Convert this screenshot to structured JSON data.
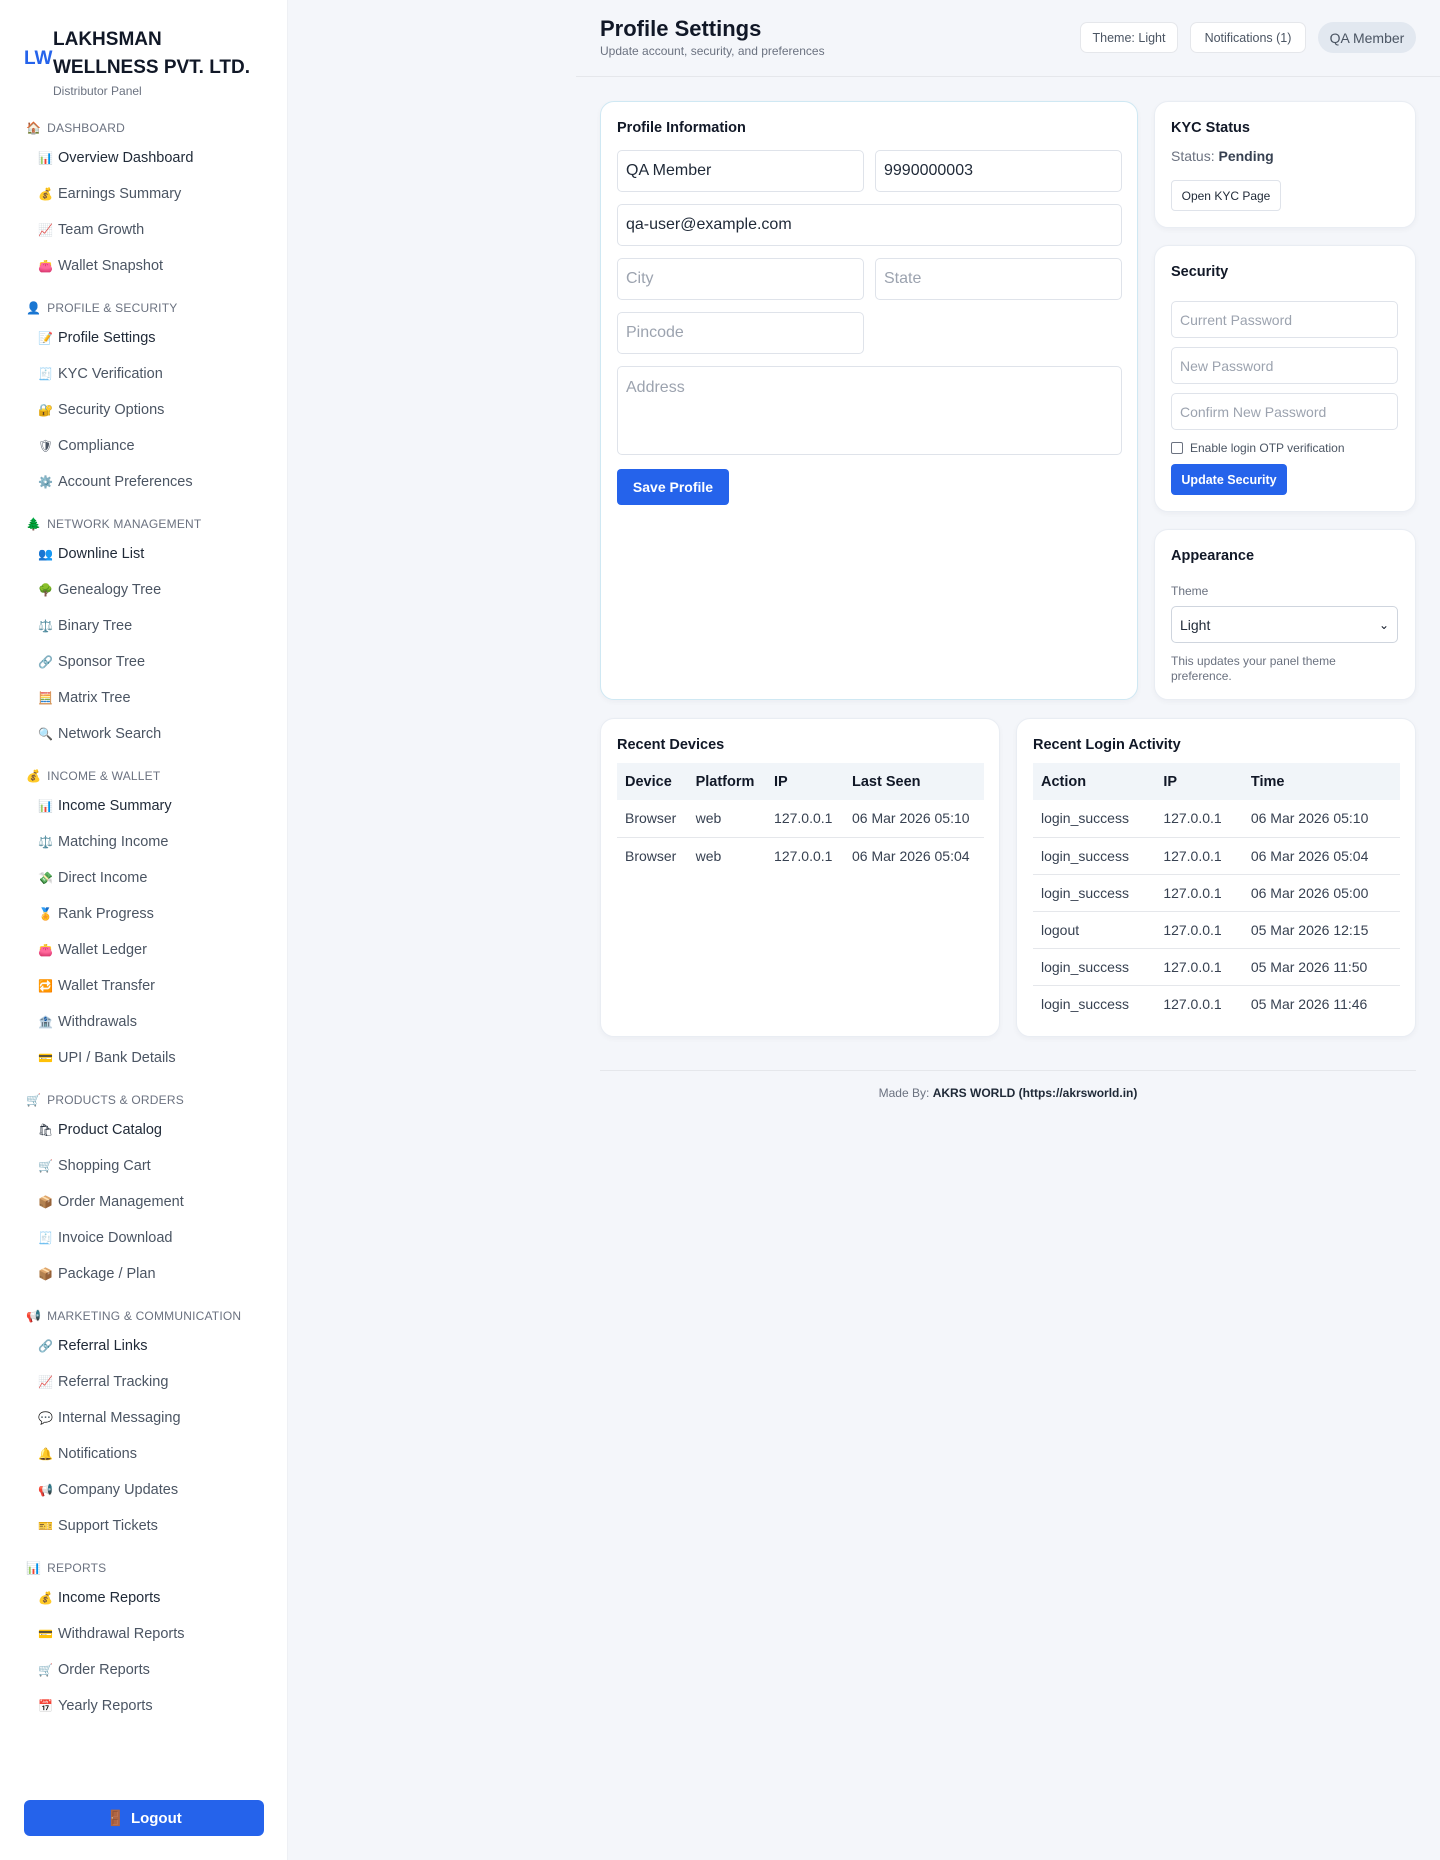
{
  "brand": {
    "logo": "LW",
    "name": "LAKHSMAN WELLNESS PVT. LTD.",
    "sub": "Distributor Panel"
  },
  "sidebar": {
    "sections": [
      {
        "heading": "DASHBOARD",
        "icon": "🏠",
        "items": [
          {
            "label": "Overview Dashboard",
            "icon": "📊"
          },
          {
            "label": "Earnings Summary",
            "icon": "💰"
          },
          {
            "label": "Team Growth",
            "icon": "📈"
          },
          {
            "label": "Wallet Snapshot",
            "icon": "👛"
          }
        ]
      },
      {
        "heading": "PROFILE & SECURITY",
        "icon": "👤",
        "items": [
          {
            "label": "Profile Settings",
            "icon": "📝"
          },
          {
            "label": "KYC Verification",
            "icon": "🧾"
          },
          {
            "label": "Security Options",
            "icon": "🔐"
          },
          {
            "label": "Compliance",
            "icon": "🛡"
          },
          {
            "label": "Account Preferences",
            "icon": "⚙️"
          }
        ]
      },
      {
        "heading": "NETWORK MANAGEMENT",
        "icon": "🌲",
        "items": [
          {
            "label": "Downline List",
            "icon": "👥"
          },
          {
            "label": "Genealogy Tree",
            "icon": "🌳"
          },
          {
            "label": "Binary Tree",
            "icon": "⚖️"
          },
          {
            "label": "Sponsor Tree",
            "icon": "🔗"
          },
          {
            "label": "Matrix Tree",
            "icon": "🧮"
          },
          {
            "label": "Network Search",
            "icon": "🔍"
          }
        ]
      },
      {
        "heading": "INCOME & WALLET",
        "icon": "💰",
        "items": [
          {
            "label": "Income Summary",
            "icon": "📊"
          },
          {
            "label": "Matching Income",
            "icon": "⚖️"
          },
          {
            "label": "Direct Income",
            "icon": "💸"
          },
          {
            "label": "Rank Progress",
            "icon": "🏅"
          },
          {
            "label": "Wallet Ledger",
            "icon": "👛"
          },
          {
            "label": "Wallet Transfer",
            "icon": "🔁"
          },
          {
            "label": "Withdrawals",
            "icon": "🏦"
          },
          {
            "label": "UPI / Bank Details",
            "icon": "💳"
          }
        ]
      },
      {
        "heading": "PRODUCTS & ORDERS",
        "icon": "🛒",
        "items": [
          {
            "label": "Product Catalog",
            "icon": "🛍"
          },
          {
            "label": "Shopping Cart",
            "icon": "🛒"
          },
          {
            "label": "Order Management",
            "icon": "📦"
          },
          {
            "label": "Invoice Download",
            "icon": "🧾"
          },
          {
            "label": "Package / Plan",
            "icon": "📦"
          }
        ]
      },
      {
        "heading": "MARKETING & COMMUNICATION",
        "icon": "📢",
        "items": [
          {
            "label": "Referral Links",
            "icon": "🔗"
          },
          {
            "label": "Referral Tracking",
            "icon": "📈"
          },
          {
            "label": "Internal Messaging",
            "icon": "💬"
          },
          {
            "label": "Notifications",
            "icon": "🔔"
          },
          {
            "label": "Company Updates",
            "icon": "📢"
          },
          {
            "label": "Support Tickets",
            "icon": "🎫"
          }
        ]
      },
      {
        "heading": "REPORTS",
        "icon": "📊",
        "items": [
          {
            "label": "Income Reports",
            "icon": "💰"
          },
          {
            "label": "Withdrawal Reports",
            "icon": "💳"
          },
          {
            "label": "Order Reports",
            "icon": "🛒"
          },
          {
            "label": "Yearly Reports",
            "icon": "📅"
          }
        ]
      }
    ],
    "logout": {
      "label": "Logout",
      "icon": "🚪"
    }
  },
  "header": {
    "title": "Profile Settings",
    "subtitle": "Update account, security, and preferences",
    "theme_btn": "Theme: Light",
    "notifications_btn": "Notifications (1)",
    "user": "QA Member"
  },
  "profile": {
    "title": "Profile Information",
    "name": "QA Member",
    "phone": "9990000003",
    "email": "qa-user@example.com",
    "city_placeholder": "City",
    "state_placeholder": "State",
    "pincode_placeholder": "Pincode",
    "address_placeholder": "Address",
    "save_label": "Save Profile"
  },
  "kyc": {
    "title": "KYC Status",
    "status_label": "Status:",
    "status_value": "Pending",
    "open_label": "Open KYC Page"
  },
  "security": {
    "title": "Security",
    "current_placeholder": "Current Password",
    "new_placeholder": "New Password",
    "confirm_placeholder": "Confirm New Password",
    "otp_label": "Enable login OTP verification",
    "update_label": "Update Security"
  },
  "appearance": {
    "title": "Appearance",
    "theme_label": "Theme",
    "theme_value": "Light",
    "hint": "This updates your panel theme preference."
  },
  "devices": {
    "title": "Recent Devices",
    "columns": [
      "Device",
      "Platform",
      "IP",
      "Last Seen"
    ],
    "rows": [
      [
        "Browser",
        "web",
        "127.0.0.1",
        "06 Mar 2026 05:10"
      ],
      [
        "Browser",
        "web",
        "127.0.0.1",
        "06 Mar 2026 05:04"
      ]
    ]
  },
  "logins": {
    "title": "Recent Login Activity",
    "columns": [
      "Action",
      "IP",
      "Time"
    ],
    "rows": [
      [
        "login_success",
        "127.0.0.1",
        "06 Mar 2026 05:10"
      ],
      [
        "login_success",
        "127.0.0.1",
        "06 Mar 2026 05:04"
      ],
      [
        "login_success",
        "127.0.0.1",
        "06 Mar 2026 05:00"
      ],
      [
        "logout",
        "127.0.0.1",
        "05 Mar 2026 12:15"
      ],
      [
        "login_success",
        "127.0.0.1",
        "05 Mar 2026 11:50"
      ],
      [
        "login_success",
        "127.0.0.1",
        "05 Mar 2026 11:46"
      ]
    ]
  },
  "footer": {
    "prefix": "Made By:",
    "credit": "AKRS WORLD (https://akrsworld.in)"
  },
  "colors": {
    "accent": "#2563eb",
    "page_bg": "#f4f6fa",
    "card_border": "#e9edf3"
  }
}
